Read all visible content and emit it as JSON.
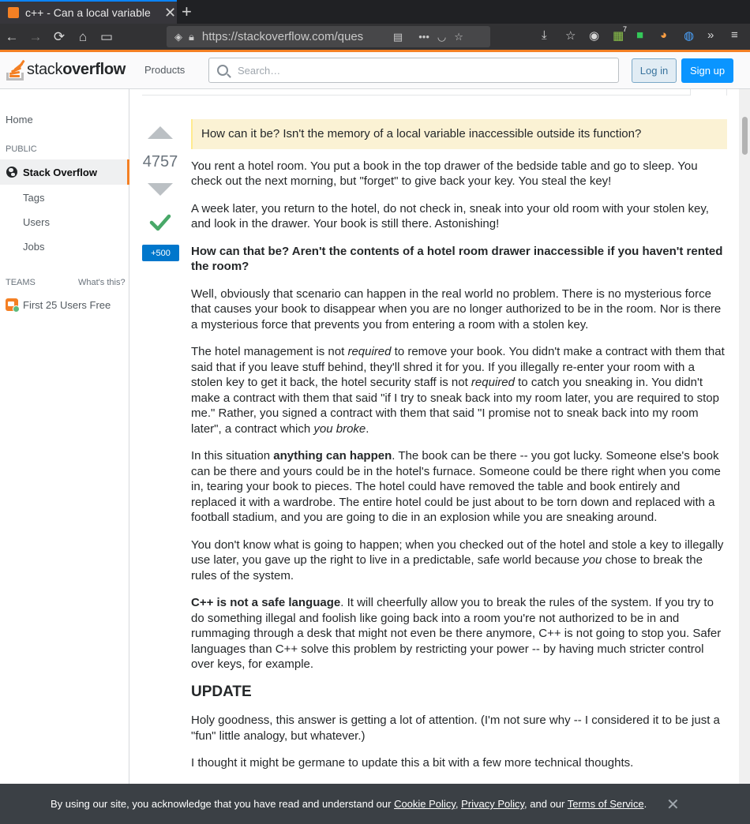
{
  "browser": {
    "tab_title": "c++ - Can a local variable",
    "tab_close": "✕",
    "new_tab": "+",
    "url": "https://stackoverflow.com/ques",
    "extension_badge": "7"
  },
  "header": {
    "logo_light": "stack",
    "logo_bold": "overflow",
    "products": "Products",
    "search_placeholder": "Search…",
    "login": "Log in",
    "signup": "Sign up"
  },
  "sidebar": {
    "home": "Home",
    "public": "PUBLIC",
    "stackoverflow": "Stack Overflow",
    "items": [
      "Tags",
      "Users",
      "Jobs"
    ],
    "teams": "TEAMS",
    "whats_this": "What's this?",
    "first25": "First 25 Users Free"
  },
  "post": {
    "vote_count": "4757",
    "bounty": "+500",
    "quote": "How can it be? Isn't the memory of a local variable inaccessible outside its function?",
    "p1": "You rent a hotel room. You put a book in the top drawer of the bedside table and go to sleep. You check out the next morning, but \"forget\" to give back your key. You steal the key!",
    "p2": "A week later, you return to the hotel, do not check in, sneak into your old room with your stolen key, and look in the drawer. Your book is still there. Astonishing!",
    "p3": "How can that be? Aren't the contents of a hotel room drawer inaccessible if you haven't rented the room?",
    "p4": "Well, obviously that scenario can happen in the real world no problem. There is no mysterious force that causes your book to disappear when you are no longer authorized to be in the room. Nor is there a mysterious force that prevents you from entering a room with a stolen key.",
    "p5": {
      "a": "The hotel management is not ",
      "b": "required",
      "c": " to remove your book. You didn't make a contract with them that said that if you leave stuff behind, they'll shred it for you. If you illegally re-enter your room with a stolen key to get it back, the hotel security staff is not ",
      "d": "required",
      "e": " to catch you sneaking in. You didn't make a contract with them that said \"if I try to sneak back into my room later, you are required to stop me.\" Rather, you signed a contract with them that said \"I promise not to sneak back into my room later\", a contract which ",
      "f": "you broke",
      "g": "."
    },
    "p6": {
      "a": "In this situation ",
      "b": "anything can happen",
      "c": ". The book can be there -- you got lucky. Someone else's book can be there and yours could be in the hotel's furnace. Someone could be there right when you come in, tearing your book to pieces. The hotel could have removed the table and book entirely and replaced it with a wardrobe. The entire hotel could be just about to be torn down and replaced with a football stadium, and you are going to die in an explosion while you are sneaking around."
    },
    "p7": {
      "a": "You don't know what is going to happen; when you checked out of the hotel and stole a key to illegally use later, you gave up the right to live in a predictable, safe world because ",
      "b": "you",
      "c": " chose to break the rules of the system."
    },
    "p8": {
      "a": "C++ is not a safe language",
      "b": ". It will cheerfully allow you to break the rules of the system. If you try to do something illegal and foolish like going back into a room you're not authorized to be in and rummaging through a desk that might not even be there anymore, C++ is not going to stop you. Safer languages than C++ solve this problem by restricting your power -- by having much stricter control over keys, for example."
    },
    "update_heading": "UPDATE",
    "p9": "Holy goodness, this answer is getting a lot of attention. (I'm not sure why -- I considered it to be just a \"fun\" little analogy, but whatever.)",
    "p10": "I thought it might be germane to update this a bit with a few more technical thoughts."
  },
  "cookie": {
    "text1": "By using our site, you acknowledge that you have read and understand our ",
    "cookie_policy": "Cookie Policy",
    "sep1": ", ",
    "privacy_policy": "Privacy Policy",
    "sep2": ", and our ",
    "terms": "Terms of Service",
    "end": ".",
    "close": "✕"
  }
}
